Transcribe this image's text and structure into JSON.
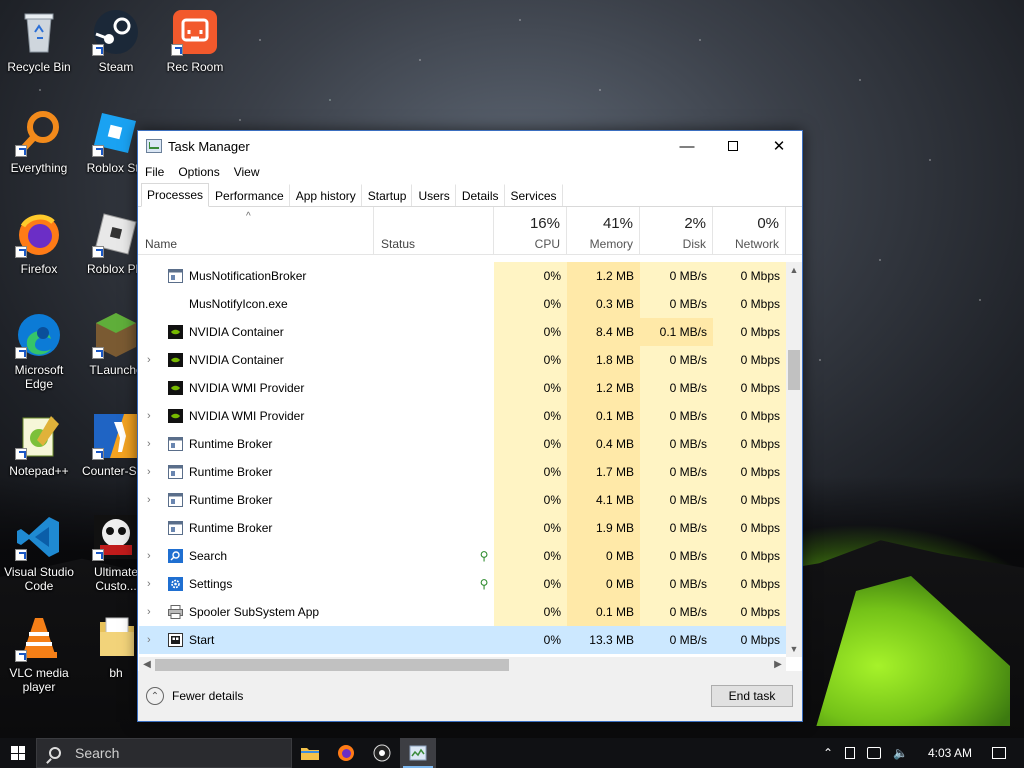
{
  "desktop": {
    "icons": [
      {
        "label": "Recycle Bin",
        "icon": "recycle-bin-icon"
      },
      {
        "label": "Steam",
        "icon": "steam-icon"
      },
      {
        "label": "Rec Room",
        "icon": "rec-room-icon"
      },
      {
        "label": "Everything",
        "icon": "everything-search-icon"
      },
      {
        "label": "Roblox Stu",
        "icon": "roblox-studio-icon"
      },
      {
        "label": "Firefox",
        "icon": "firefox-icon"
      },
      {
        "label": "Roblox Pla",
        "icon": "roblox-player-icon"
      },
      {
        "label": "Microsoft Edge",
        "icon": "edge-icon"
      },
      {
        "label": "TLaunche",
        "icon": "tlauncher-icon"
      },
      {
        "label": "Notepad++",
        "icon": "notepad-plus-plus-icon"
      },
      {
        "label": "Counter-St 2",
        "icon": "counter-strike-icon"
      },
      {
        "label": "Visual Studio Code",
        "icon": "vscode-icon"
      },
      {
        "label": "Ultimate Custo...",
        "icon": "ucn-icon"
      },
      {
        "label": "VLC media player",
        "icon": "vlc-icon"
      },
      {
        "label": "bh",
        "icon": "folder-icon"
      }
    ]
  },
  "window": {
    "title": "Task Manager",
    "menu": [
      "File",
      "Options",
      "View"
    ],
    "tabs": [
      "Processes",
      "Performance",
      "App history",
      "Startup",
      "Users",
      "Details",
      "Services"
    ],
    "active_tab": "Processes"
  },
  "columns": {
    "name": "Name",
    "status": "Status",
    "cpu": {
      "pct": "16%",
      "label": "CPU"
    },
    "memory": {
      "pct": "41%",
      "label": "Memory"
    },
    "disk": {
      "pct": "2%",
      "label": "Disk"
    },
    "network": {
      "pct": "0%",
      "label": "Network"
    }
  },
  "processes": [
    {
      "name": "MusNotificationBroker",
      "expand": "",
      "icon": "app-window-icon",
      "eco": "",
      "cpu": "0%",
      "memory": "1.2 MB",
      "disk": "0 MB/s",
      "network": "0 Mbps"
    },
    {
      "name": "MusNotifyIcon.exe",
      "expand": "",
      "icon": "",
      "eco": "",
      "cpu": "0%",
      "memory": "0.3 MB",
      "disk": "0 MB/s",
      "network": "0 Mbps"
    },
    {
      "name": "NVIDIA Container",
      "expand": "",
      "icon": "nvidia-icon",
      "eco": "",
      "cpu": "0%",
      "memory": "8.4 MB",
      "disk": "0.1 MB/s",
      "network": "0 Mbps"
    },
    {
      "name": "NVIDIA Container",
      "expand": "›",
      "icon": "nvidia-icon",
      "eco": "",
      "cpu": "0%",
      "memory": "1.8 MB",
      "disk": "0 MB/s",
      "network": "0 Mbps"
    },
    {
      "name": "NVIDIA WMI Provider",
      "expand": "",
      "icon": "nvidia-icon",
      "eco": "",
      "cpu": "0%",
      "memory": "1.2 MB",
      "disk": "0 MB/s",
      "network": "0 Mbps"
    },
    {
      "name": "NVIDIA WMI Provider",
      "expand": "›",
      "icon": "nvidia-icon",
      "eco": "",
      "cpu": "0%",
      "memory": "0.1 MB",
      "disk": "0 MB/s",
      "network": "0 Mbps"
    },
    {
      "name": "Runtime Broker",
      "expand": "›",
      "icon": "app-window-icon",
      "eco": "",
      "cpu": "0%",
      "memory": "0.4 MB",
      "disk": "0 MB/s",
      "network": "0 Mbps"
    },
    {
      "name": "Runtime Broker",
      "expand": "›",
      "icon": "app-window-icon",
      "eco": "",
      "cpu": "0%",
      "memory": "1.7 MB",
      "disk": "0 MB/s",
      "network": "0 Mbps"
    },
    {
      "name": "Runtime Broker",
      "expand": "›",
      "icon": "app-window-icon",
      "eco": "",
      "cpu": "0%",
      "memory": "4.1 MB",
      "disk": "0 MB/s",
      "network": "0 Mbps"
    },
    {
      "name": "Runtime Broker",
      "expand": "",
      "icon": "app-window-icon",
      "eco": "",
      "cpu": "0%",
      "memory": "1.9 MB",
      "disk": "0 MB/s",
      "network": "0 Mbps"
    },
    {
      "name": "Search",
      "expand": "›",
      "icon": "search-app-icon",
      "eco": "⚲",
      "cpu": "0%",
      "memory": "0 MB",
      "disk": "0 MB/s",
      "network": "0 Mbps"
    },
    {
      "name": "Settings",
      "expand": "›",
      "icon": "settings-gear-icon",
      "eco": "⚲",
      "cpu": "0%",
      "memory": "0 MB",
      "disk": "0 MB/s",
      "network": "0 Mbps"
    },
    {
      "name": "Spooler SubSystem App",
      "expand": "›",
      "icon": "printer-icon",
      "eco": "",
      "cpu": "0%",
      "memory": "0.1 MB",
      "disk": "0 MB/s",
      "network": "0 Mbps"
    },
    {
      "name": "Start",
      "expand": "›",
      "icon": "start-app-icon",
      "eco": "",
      "cpu": "0%",
      "memory": "13.3 MB",
      "disk": "0 MB/s",
      "network": "0 Mbps",
      "selected": true
    }
  ],
  "footer": {
    "fewer_details": "Fewer details",
    "end_task": "End task"
  },
  "taskbar": {
    "search_placeholder": "Search",
    "apps": [
      "file-explorer-icon",
      "firefox-icon",
      "obs-icon",
      "task-manager-icon"
    ],
    "time": "4:03 AM"
  },
  "colors": {
    "cpu_bg": "#fff4c4",
    "memory_bg": "#ffe9a8",
    "selection": "#cce8ff",
    "accent": "#0078d7"
  }
}
